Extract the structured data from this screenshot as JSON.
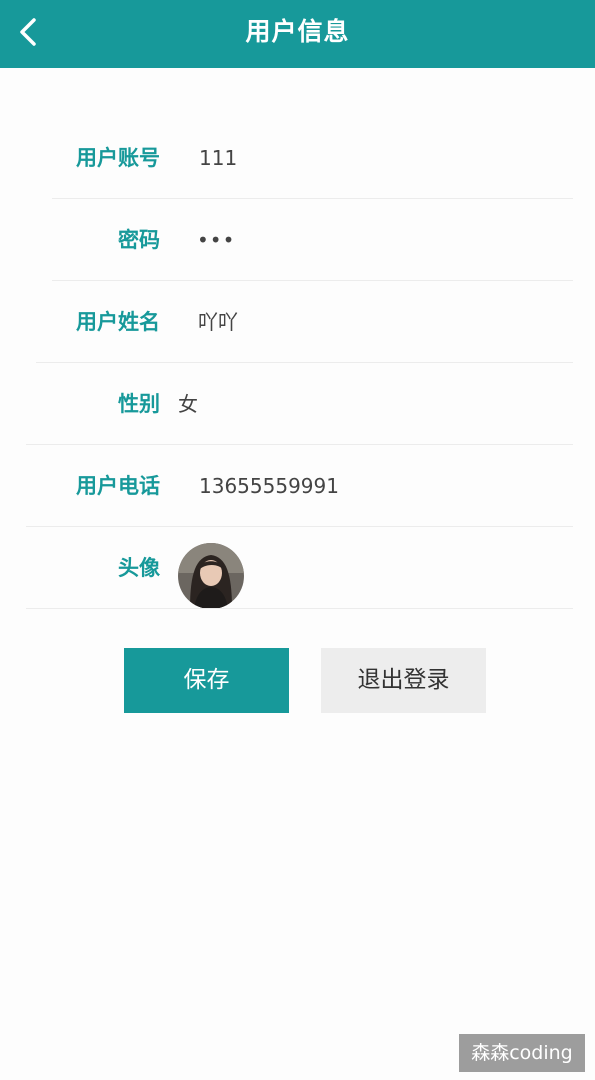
{
  "header": {
    "title": "用户信息",
    "back_icon": "chevron-left-icon",
    "background": "#17999a"
  },
  "form": {
    "fields": [
      {
        "label": "用户账号",
        "value": "111"
      },
      {
        "label": "密码",
        "value": "•••"
      },
      {
        "label": "用户姓名",
        "value": "吖吖"
      },
      {
        "label": "性别",
        "value": "女"
      },
      {
        "label": "用户电话",
        "value": "13655559991"
      },
      {
        "label": "头像",
        "value": ""
      }
    ]
  },
  "actions": {
    "save_label": "保存",
    "logout_label": "退出登录"
  },
  "watermark": "森森coding",
  "colors": {
    "accent": "#17999a",
    "secondary_button": "#ededed"
  }
}
